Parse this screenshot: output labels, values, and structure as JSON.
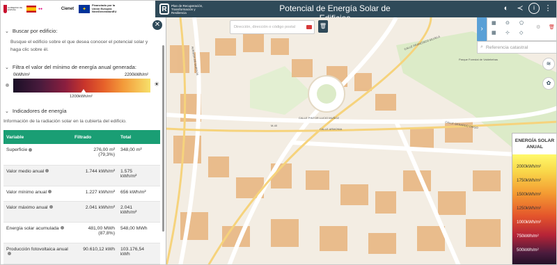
{
  "header": {
    "logos": {
      "gov_text": "GOBIERNO DE ESPAÑA",
      "eu_text": "Financiado por la Unión Europea NextGenerationEU",
      "cienet": "Cienet",
      "prtr_text": "Plan de Recuperación, Transformación y Resiliencia"
    },
    "title": "Potencial de Energía Solar de Edificios",
    "icons": [
      "theme-icon",
      "share-icon",
      "info-icon",
      "menu-dots-icon"
    ]
  },
  "panel": {
    "search": {
      "heading": "Buscar por edificio:",
      "text": "Busque el edificio sobre el que desea conocer el potencial solar y haga clic sobre él."
    },
    "filter": {
      "heading": "Filtra el valor del mínimo de energía anual generada:",
      "min_label": "0kWh/m²",
      "max_label": "2200kWh/m²",
      "marker_label": "1200kWh/m²"
    },
    "indicators": {
      "heading": "Indicadores de energía",
      "subtitle": "Información de la radiación solar en la cubierta del edificio.",
      "columns": [
        "Variable",
        "Filtrado",
        "Total"
      ],
      "rows": [
        {
          "variable": "Superficie",
          "filtrado": "276,00 m²",
          "filtrado2": "(79,3%)",
          "total": "348,00 m²"
        },
        {
          "variable": "Valor medio anual",
          "filtrado": "1.744 kWh/m²",
          "filtrado2": "",
          "total": "1.575",
          "total2": "kWh/m²"
        },
        {
          "variable": "Valor mínimo anual",
          "filtrado": "1.227 kWh/m²",
          "filtrado2": "",
          "total": "656 kWh/m²"
        },
        {
          "variable": "Valor máximo anual",
          "filtrado": "2.041 kWh/m²",
          "filtrado2": "",
          "total": "2.041",
          "total2": "kWh/m²"
        },
        {
          "variable": "Energía solar acumulada",
          "filtrado": "481,00 MWh",
          "filtrado2": "(87,8%)",
          "total": "548,00 MWh"
        },
        {
          "variable": "Producción fotovoltaica anual",
          "filtrado": "90.610,12 kWh",
          "filtrado2": "",
          "total": "103.176,54",
          "total2": "kWh"
        }
      ]
    }
  },
  "map": {
    "search_placeholder": "Dirección, dirección o código postal",
    "cadastral_placeholder": "Referencia catastral",
    "street_labels": [
      "CALLE FRANCISCO SILVELA",
      "AVENIDA DE BURGOS",
      "CALLE PINTOR LUCIO MUÑOZ",
      "CALLE ARMONIA",
      "Parque Forestal de Valdebebas",
      "CALLE GERARDO DIEGO",
      "M-40"
    ],
    "legend": {
      "title": "ENERGÍA SOLAR ANUAL",
      "items": [
        "2000kWh/m²",
        "1750kWh/m²",
        "1500kWh/m²",
        "1250kWh/m²",
        "1000kWh/m²",
        "750kWh/m²",
        "500kWh/m²"
      ]
    }
  }
}
